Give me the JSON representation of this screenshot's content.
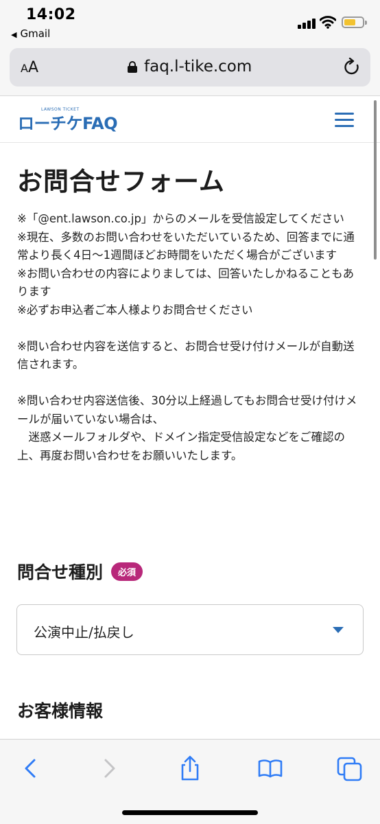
{
  "status_bar": {
    "time": "14:02",
    "back_app": "Gmail"
  },
  "browser": {
    "text_size_button": {
      "small": "A",
      "large": "A"
    },
    "url": "faq.l-tike.com"
  },
  "site_header": {
    "logo_small": "LAWSON TICKET",
    "logo_text": "ローチケFAQ"
  },
  "main": {
    "page_title": "お問合せフォーム",
    "notice_lines": [
      "※「@ent.lawson.co.jp」からのメールを受信設定してください",
      "※現在、多数のお問い合わせをいただいているため、回答までに通常より長く4日〜1週間ほどお時間をいただく場合がございます",
      "※お問い合わせの内容によりましては、回答いたしかねることもあります",
      "※必ずお申込者ご本人様よりお問合せください",
      "※問い合わせ内容を送信すると、お問合せ受け付けメールが自動送信されます。",
      "※問い合わせ内容送信後、30分以上経過してもお問合せ受け付けメールが届いていない場合は、",
      "　迷惑メールフォルダや、ドメイン指定受信設定などをご確認の上、再度お問い合わせをお願いいたします。"
    ],
    "inquiry_type": {
      "label": "問合せ種別",
      "required_badge": "必須",
      "selected_value": "公演中止/払戻し"
    },
    "customer_info": {
      "label": "お客様情報"
    }
  },
  "colors": {
    "brand_blue": "#2a6db5",
    "required_magenta": "#b8287a",
    "ios_blue": "#2f7cf6"
  },
  "toolbar_icons": [
    "back-icon",
    "forward-icon",
    "share-icon",
    "bookmarks-icon",
    "tabs-icon"
  ]
}
